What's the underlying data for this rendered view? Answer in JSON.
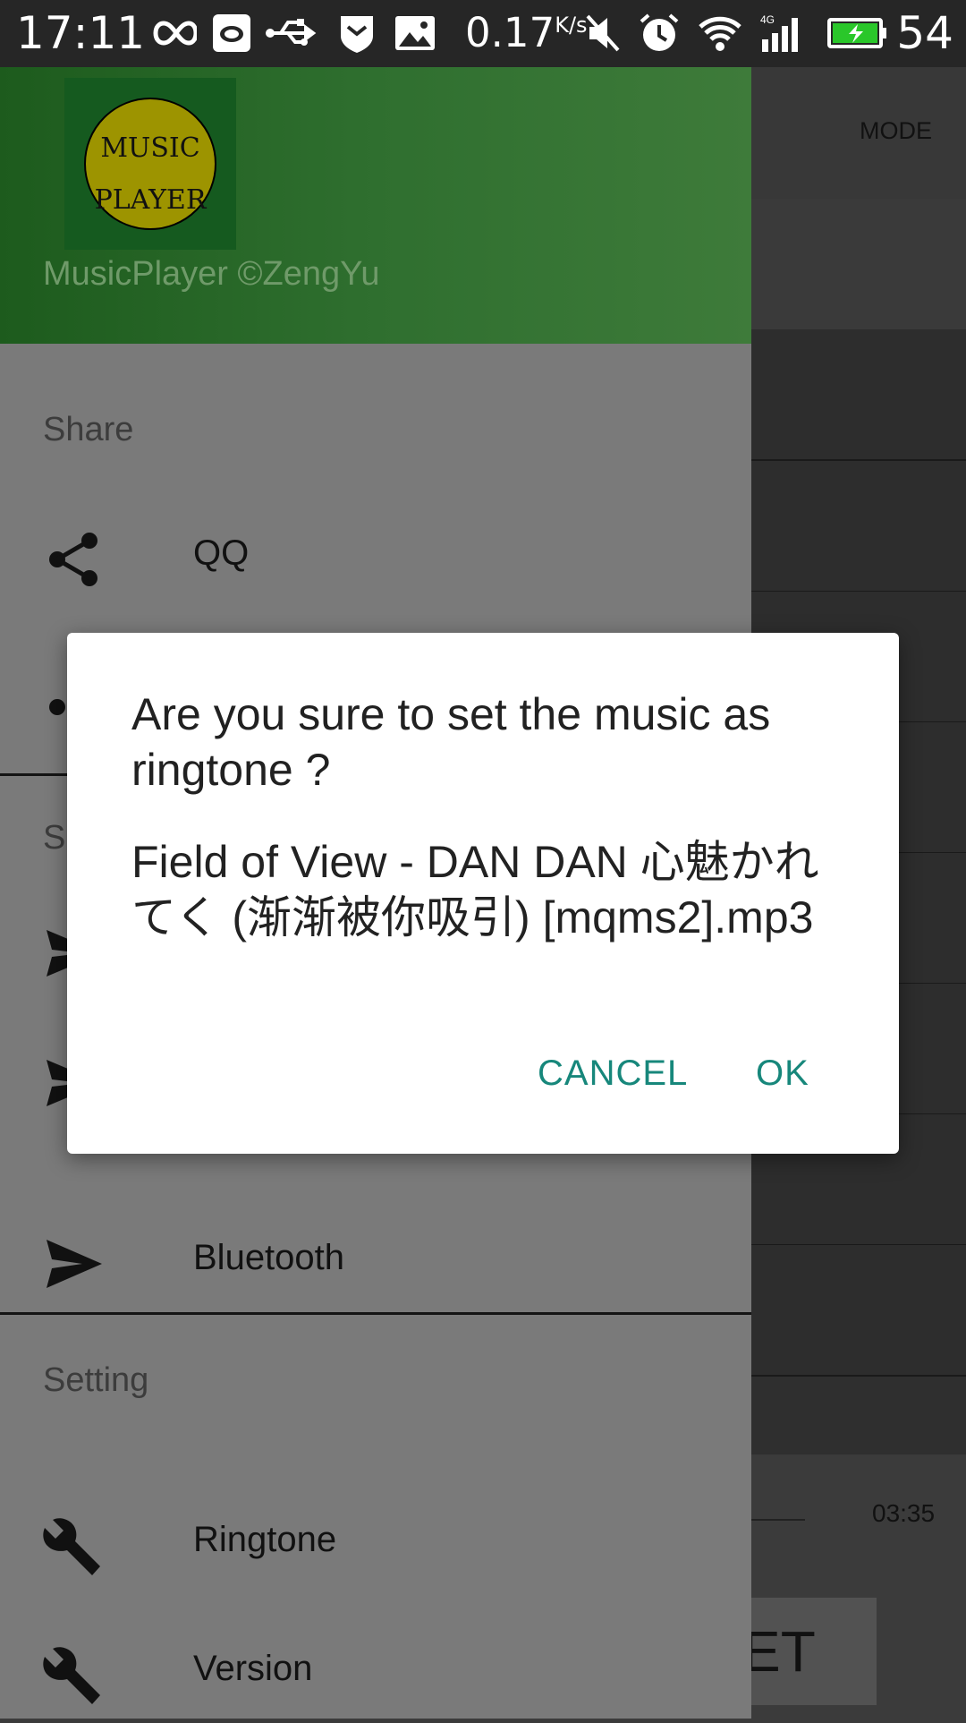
{
  "status_bar": {
    "time": "17:11",
    "net_speed": "0.17",
    "net_speed_unit": "K/s",
    "network_type": "4G",
    "battery_level": "54",
    "icons": [
      "infinity-icon",
      "chat-notification-icon",
      "usb-icon",
      "shield-icon",
      "image-icon",
      "mute-icon",
      "alarm-icon",
      "wifi-icon",
      "signal-icon",
      "battery-charging-icon"
    ]
  },
  "background_app": {
    "mode_label": "MODE",
    "current_time": "03:35",
    "button_partial_text": "ET"
  },
  "drawer": {
    "app_name": "MusicPlayer ©ZengYu",
    "logo_line1": "MUSIC",
    "logo_line2": "PLAYER",
    "share_section": {
      "title": "Share",
      "items": [
        {
          "label": "QQ",
          "icon": "share-icon"
        }
      ]
    },
    "send_section": {
      "items": [
        {
          "label": "Bluetooth",
          "icon": "send-icon"
        }
      ]
    },
    "setting_section": {
      "title": "Setting",
      "items": [
        {
          "label": "Ringtone",
          "icon": "wrench-icon"
        },
        {
          "label": "Version",
          "icon": "wrench-icon"
        }
      ]
    }
  },
  "dialog": {
    "title": "Are you sure to set the music as ringtone ?",
    "message": "Field of View - DAN DAN 心魅かれてく (渐渐被你吸引) [mqms2].mp3",
    "cancel_label": "CANCEL",
    "ok_label": "OK"
  },
  "colors": {
    "accent": "#17877b",
    "drawer_header": "#2f6f2f",
    "scrim": "#7a7a7a"
  }
}
